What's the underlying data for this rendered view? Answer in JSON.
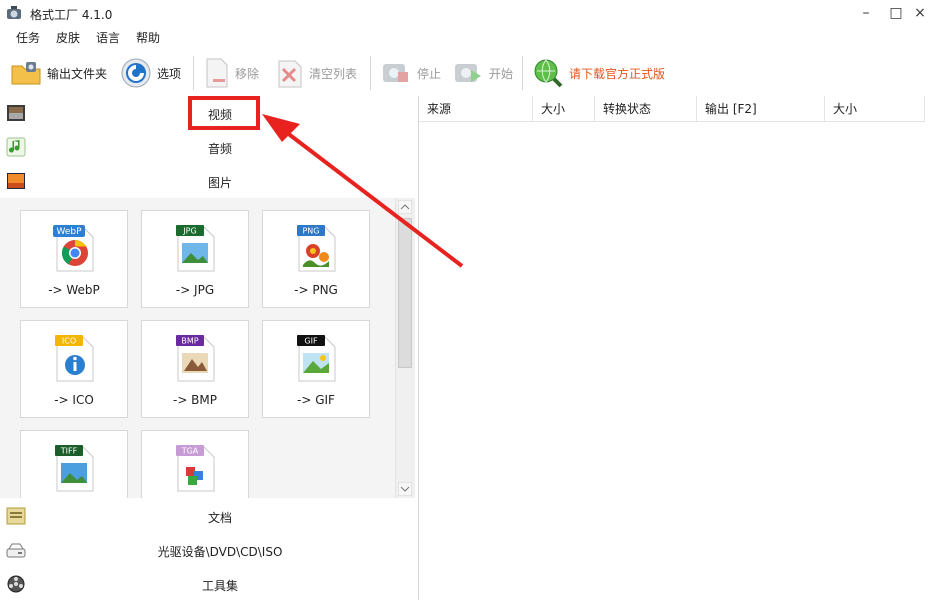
{
  "window": {
    "title": "格式工厂 4.1.0",
    "minimize": "–",
    "maximize": "□",
    "close": "×"
  },
  "menu": [
    "任务",
    "皮肤",
    "语言",
    "帮助"
  ],
  "toolbar": {
    "output_folder": "输出文件夹",
    "options": "选项",
    "remove": "移除",
    "clear_list": "清空列表",
    "stop": "停止",
    "start": "开始",
    "download_official": "请下载官方正式版"
  },
  "categories": {
    "video": "视频",
    "audio": "音频",
    "image": "图片",
    "document": "文档",
    "disc": "光驱设备\\DVD\\CD\\ISO",
    "tools": "工具集"
  },
  "formats": [
    {
      "badge": "WebP",
      "label": "-> WebP",
      "color": "#2d7fd3"
    },
    {
      "badge": "JPG",
      "label": "-> JPG",
      "color": "#1b6b2e"
    },
    {
      "badge": "PNG",
      "label": "-> PNG",
      "color": "#2f78c4"
    },
    {
      "badge": "ICO",
      "label": "-> ICO",
      "color": "#f2b705"
    },
    {
      "badge": "BMP",
      "label": "-> BMP",
      "color": "#6a2aa0"
    },
    {
      "badge": "GIF",
      "label": "-> GIF",
      "color": "#111111"
    },
    {
      "badge": "TIFF",
      "label": "",
      "color": "#1b5e2a"
    },
    {
      "badge": "TGA",
      "label": "",
      "color": "#c79bd6"
    }
  ],
  "table": {
    "columns": [
      "来源",
      "大小",
      "转换状态",
      "输出 [F2]",
      "大小"
    ]
  },
  "colors": {
    "highlight": "#e8231f",
    "download_link": "#e2571e"
  }
}
